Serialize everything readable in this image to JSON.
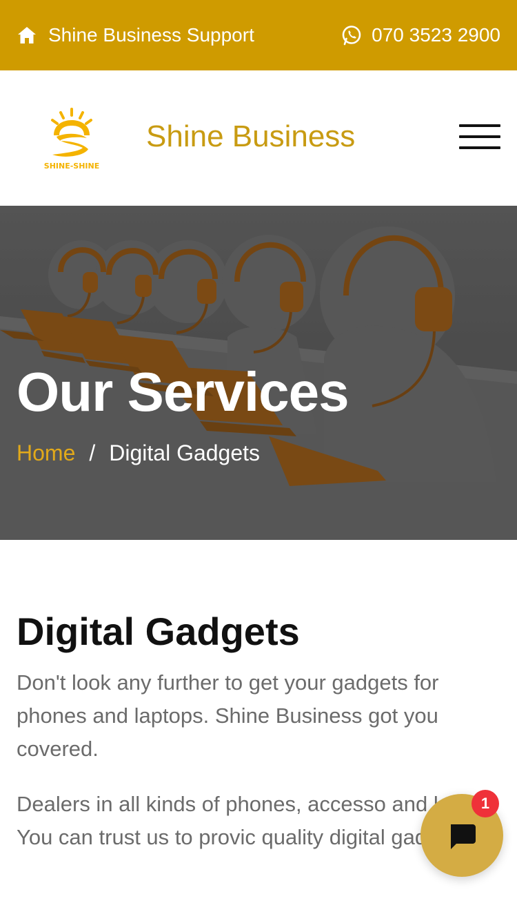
{
  "topbar": {
    "support_label": "Shine Business Support",
    "support_icon": "home-icon",
    "phone": "070 3523 2900",
    "phone_icon": "whatsapp-icon",
    "background": "#cf9b00"
  },
  "header": {
    "logo_text": "SHINE-SHINE",
    "brand_name": "Shine Business",
    "brand_color": "#c89b12",
    "menu_icon": "hamburger-menu-icon"
  },
  "hero": {
    "title": "Our Services",
    "breadcrumb": {
      "home": "Home",
      "separator": "/",
      "current": "Digital Gadgets"
    }
  },
  "content": {
    "title": "Digital Gadgets",
    "paragraphs": [
      "Don't look any further to get your gadgets for phones and laptops. Shine Business got you covered.",
      "Dealers in all kinds of phones, accesso and laptop. You can trust us to provic quality digital gadgets."
    ]
  },
  "chat": {
    "icon": "chat-icon",
    "badge_count": "1",
    "accent": "#d4ac44",
    "badge_color": "#ef3139"
  }
}
